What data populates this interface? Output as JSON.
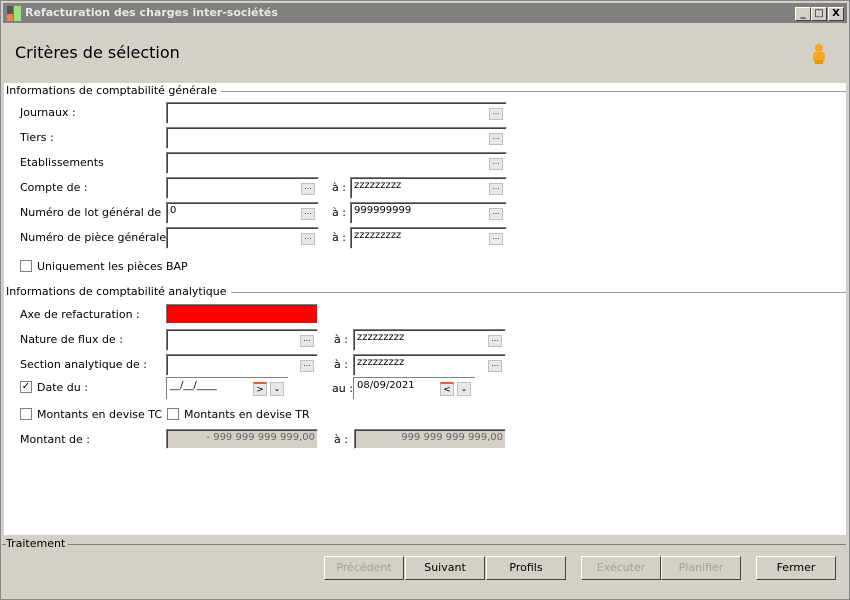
{
  "window": {
    "title": "Refacturation des charges inter-sociétés",
    "minimize": "_",
    "maximize": "□",
    "close": "X"
  },
  "header": {
    "title": "Critères de sélection",
    "user_icon": "user-icon"
  },
  "general": {
    "legend": "Informations de comptabilité générale",
    "journaux": {
      "label": "Journaux :",
      "value": ""
    },
    "tiers": {
      "label": "Tiers :",
      "value": ""
    },
    "etablissements": {
      "label": "Etablissements",
      "value": ""
    },
    "compte": {
      "label": "Compte de :",
      "from": "",
      "to_label": "à :",
      "to": "zzzzzzzzz"
    },
    "lot": {
      "label": "Numéro de lot général de :",
      "from": "0",
      "to_label": "à :",
      "to": "999999999"
    },
    "piece": {
      "label": "Numéro de pièce générale de :",
      "from": "",
      "to_label": "à :",
      "to": "zzzzzzzzz"
    },
    "bap": {
      "label": "Uniquement les pièces BAP",
      "checked": false
    }
  },
  "analytic": {
    "legend": "Informations de comptabilité analytique",
    "axe": {
      "label": "Axe de refacturation :",
      "value": "",
      "error_color": "#ff0000"
    },
    "nature": {
      "label": "Nature de flux de :",
      "from": "",
      "to_label": "à :",
      "to": "zzzzzzzzz"
    },
    "section": {
      "label": "Section analytique de :",
      "from": "",
      "to_label": "à :",
      "to": "zzzzzzzzz"
    },
    "date": {
      "label": "Date du :",
      "checked": true,
      "from": "__/__/____",
      "to_label": "au :",
      "to": "08/09/2021"
    },
    "devise_tc": {
      "label": "Montants en devise TC",
      "checked": false
    },
    "devise_tr": {
      "label": "Montants en devise TR",
      "checked": false
    },
    "montant": {
      "label": "Montant de :",
      "from": "- 999 999 999 999,00",
      "to_label": "à :",
      "to": "999 999 999 999,00"
    }
  },
  "footer": {
    "legend": "Traitement",
    "buttons": [
      {
        "label": "Précédent",
        "enabled": false
      },
      {
        "label": "Suivant",
        "enabled": true
      },
      {
        "label": "Profils",
        "enabled": true
      },
      {
        "label": "Exécuter",
        "enabled": false
      },
      {
        "label": "Planifier",
        "enabled": false
      },
      {
        "label": "Fermer",
        "enabled": true
      }
    ],
    "ellipsis": "..."
  }
}
